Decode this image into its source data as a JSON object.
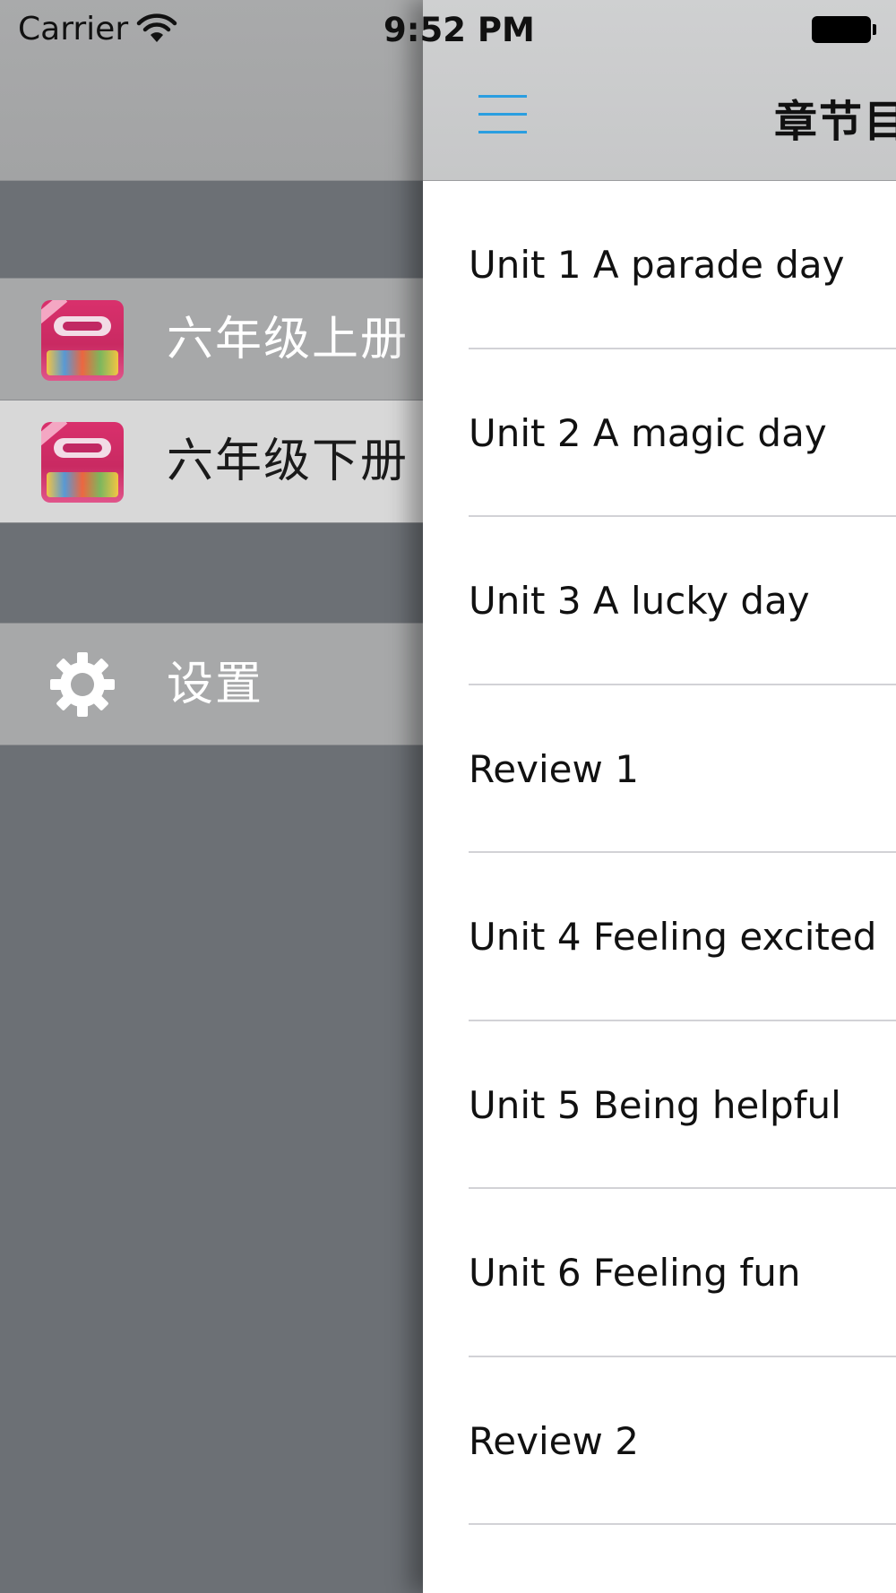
{
  "status_bar": {
    "carrier": "Carrier",
    "time": "9:52 PM"
  },
  "sidebar": {
    "books": [
      {
        "label": "六年级上册",
        "icon": "book-cover-icon",
        "selected": false
      },
      {
        "label": "六年级下册",
        "icon": "book-cover-icon",
        "selected": true
      }
    ],
    "settings": {
      "label": "设置",
      "icon": "gear-icon"
    }
  },
  "main": {
    "title": "章节目",
    "menu_icon": "hamburger-menu-icon",
    "chapters": [
      "Unit 1 A parade day",
      "Unit 2 A magic day",
      "Unit 3 A lucky day",
      "Review 1",
      "Unit 4 Feeling excited",
      "Unit 5 Being helpful",
      "Unit 6 Feeling fun",
      "Review 2"
    ]
  },
  "colors": {
    "accent": "#2a9ee0",
    "sidebar_bg": "#6c7075",
    "selected_row": "#d8d8d8",
    "row_bg": "#a7a8a9"
  }
}
